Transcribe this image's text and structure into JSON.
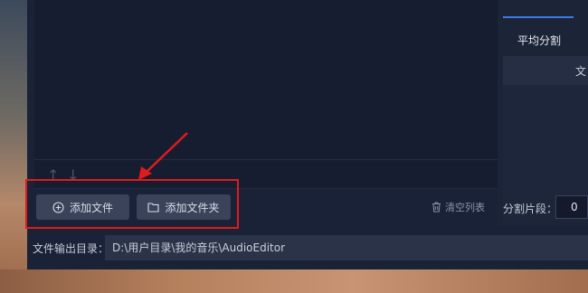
{
  "list": {
    "up_icon": "arrow-up-icon",
    "down_icon": "arrow-down-icon"
  },
  "toolbar": {
    "add_file_label": "添加文件",
    "add_folder_label": "添加文件夹",
    "clear_list_label": "清空列表"
  },
  "output": {
    "label": "文件输出目录：",
    "path": "D:\\用户目录\\我的音乐\\AudioEditor"
  },
  "right_panel": {
    "tab_label": "平均分割",
    "header_text": "文",
    "segment_label": "分割片段：",
    "segment_value": "0"
  },
  "colors": {
    "accent": "#3b7be8",
    "annotation": "#e01b1b",
    "panel_bg": "#1a2238"
  }
}
